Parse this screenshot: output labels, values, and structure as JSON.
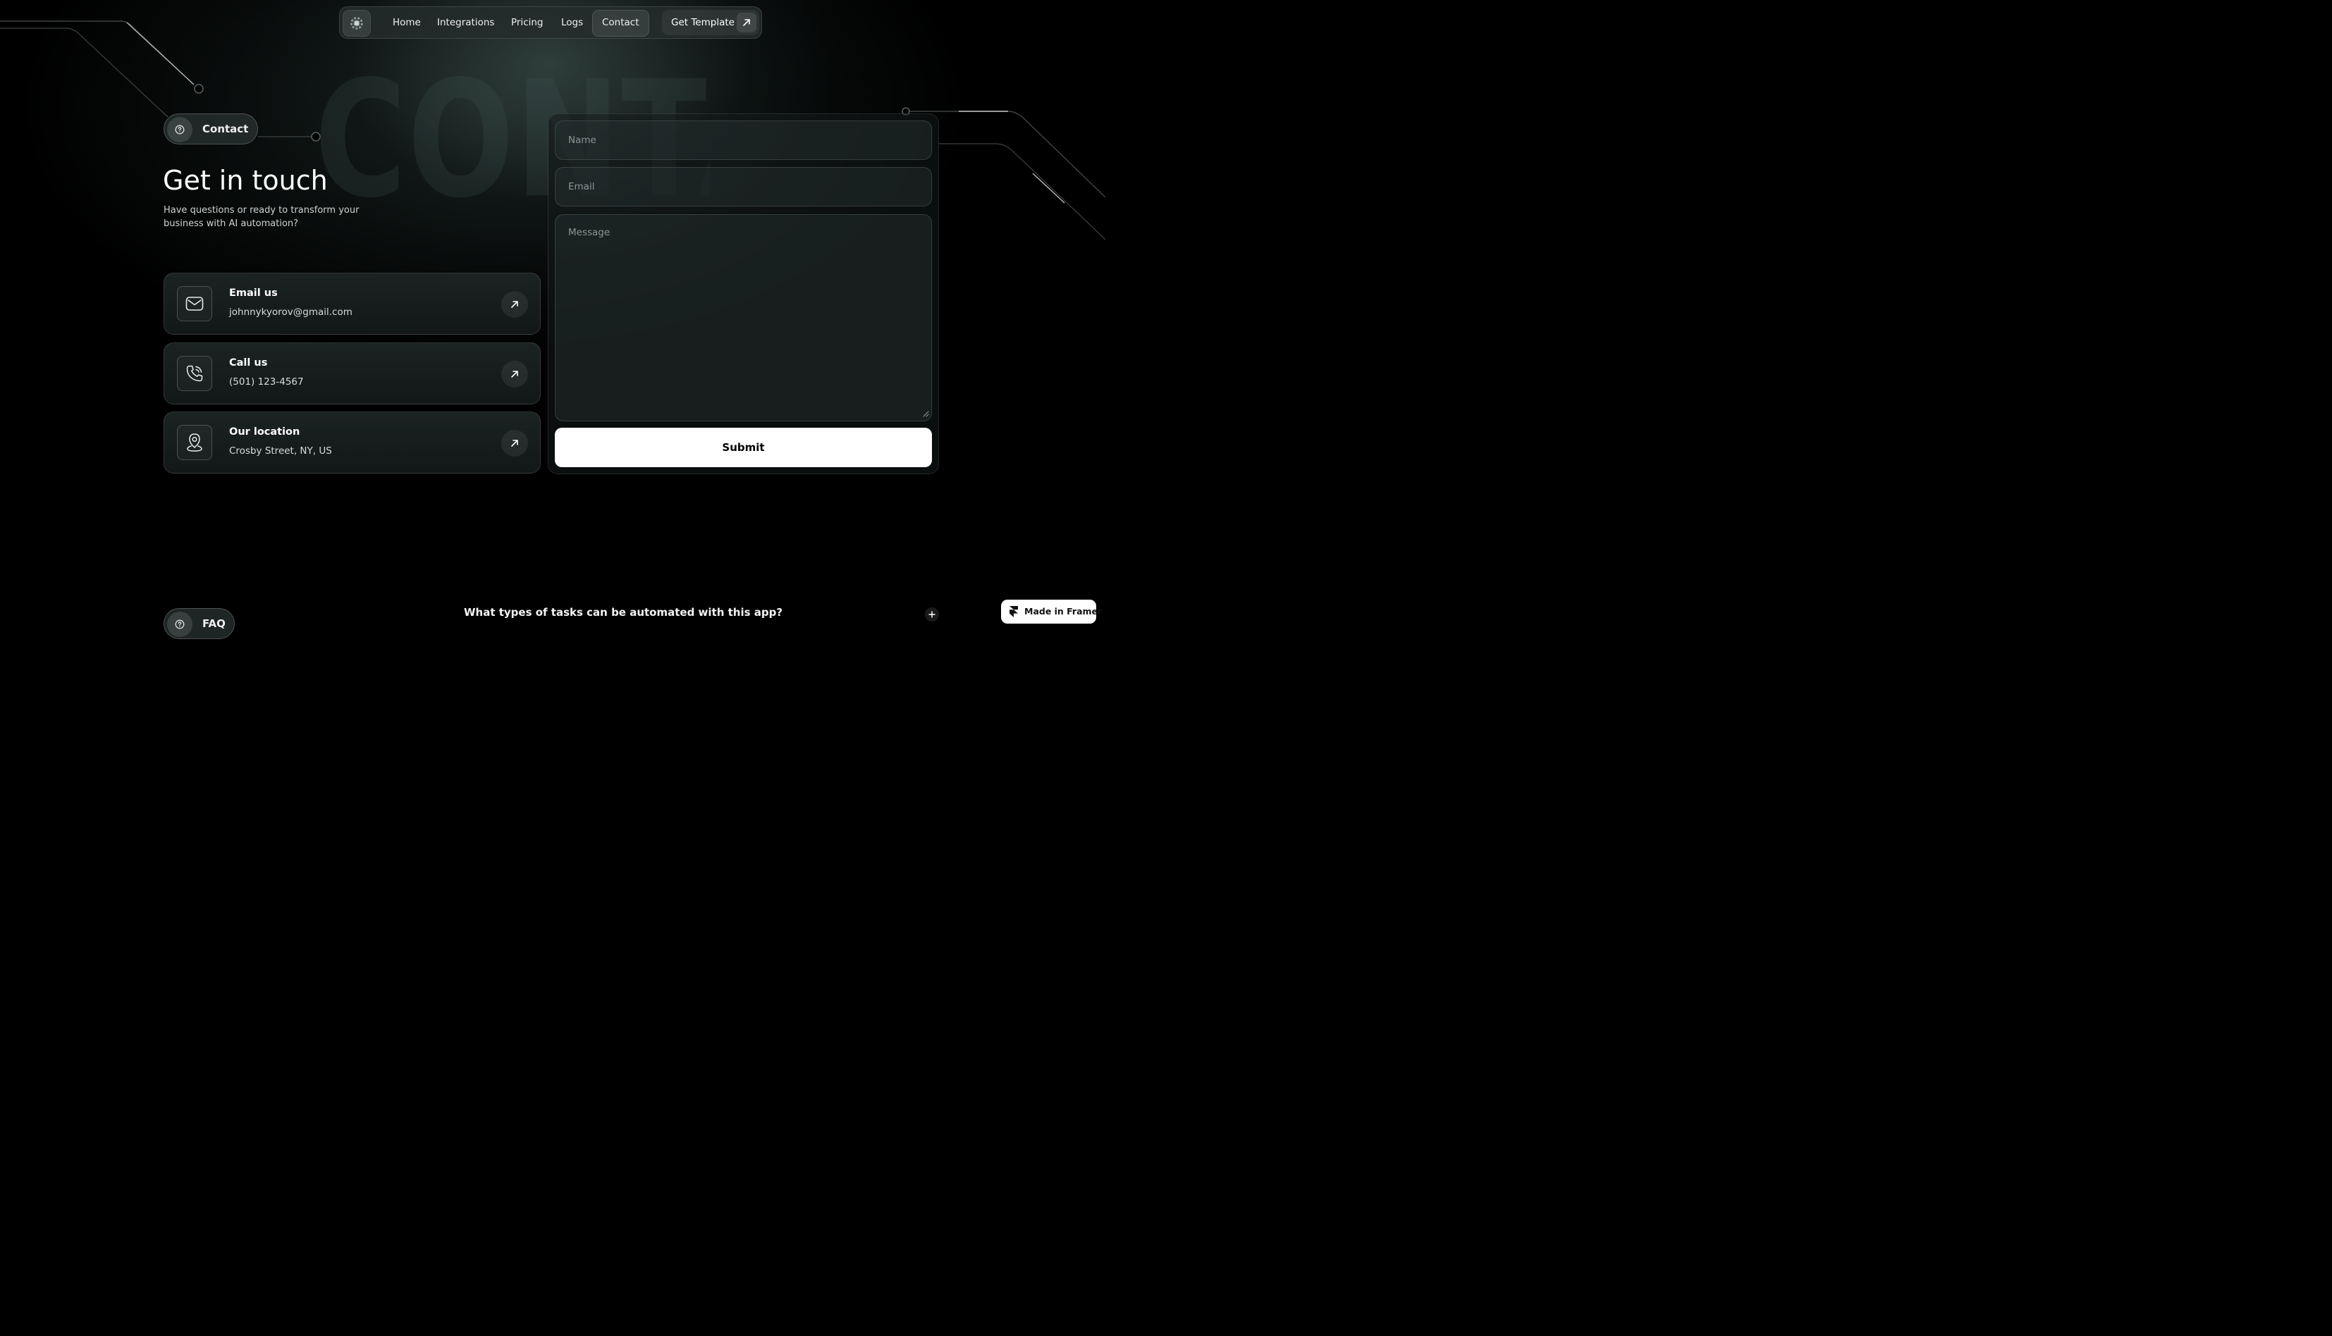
{
  "nav": {
    "logo_icon": "gear-chip-icon",
    "links": [
      "Home",
      "Integrations",
      "Pricing",
      "Logs",
      "Contact"
    ],
    "active": "Contact",
    "cta_label": "Get Template",
    "cta_icon": "arrow-up-right-icon"
  },
  "hero": {
    "background_word": "CONTACT",
    "badge_label": "Contact",
    "badge_icon": "help-circle-icon",
    "title": "Get in touch",
    "subtitle": "Have questions or ready to transform your business with AI automation?"
  },
  "contact_cards": [
    {
      "title": "Email us",
      "value": "johnnykyorov@gmail.com",
      "icon": "mail-icon"
    },
    {
      "title": "Call us",
      "value": "(501) 123-4567",
      "icon": "phone-icon"
    },
    {
      "title": "Our location",
      "value": "Crosby Street, NY, US",
      "icon": "location-pin-icon"
    }
  ],
  "form": {
    "name_placeholder": "Name",
    "email_placeholder": "Email",
    "message_placeholder": "Message",
    "submit_label": "Submit"
  },
  "faq": {
    "badge_label": "FAQ",
    "badge_icon": "help-circle-icon",
    "first_question": "What types of tasks can be automated with this app?",
    "expand_icon": "plus-icon"
  },
  "framer_badge": {
    "label": "Made in Framer",
    "icon": "framer-logo-icon"
  },
  "colors": {
    "background": "#000000",
    "accent": "#ffffff",
    "surface": "#1c2424"
  }
}
